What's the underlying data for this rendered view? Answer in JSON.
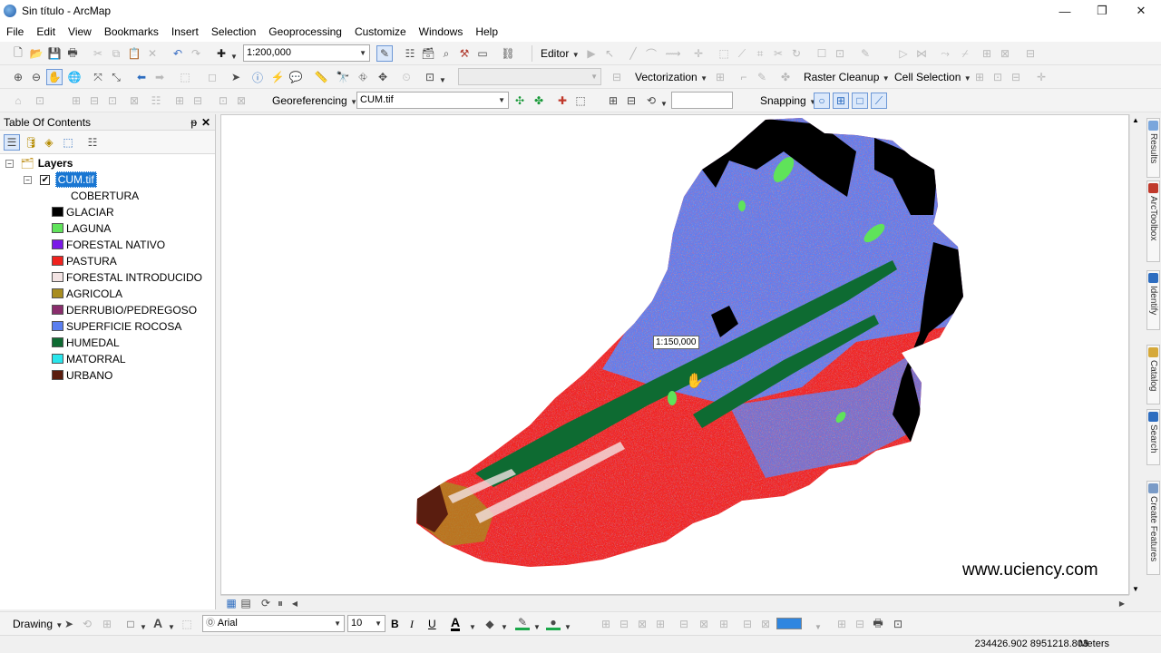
{
  "window": {
    "title": "Sin título - ArcMap"
  },
  "menu": [
    "File",
    "Edit",
    "View",
    "Bookmarks",
    "Insert",
    "Selection",
    "Geoprocessing",
    "Customize",
    "Windows",
    "Help"
  ],
  "toolbar": {
    "scale": "1:200,000",
    "editor": "Editor",
    "vectorization": "Vectorization",
    "raster_cleanup": "Raster Cleanup",
    "cell_selection": "Cell Selection",
    "georeferencing": "Georeferencing",
    "georef_layer": "CUM.tif",
    "snapping": "Snapping"
  },
  "toc": {
    "title": "Table Of Contents",
    "pin": "ᵽ",
    "close": "✕",
    "layers_label": "Layers",
    "layer_name": "CUM.tif",
    "field_name": "COBERTURA",
    "classes": [
      {
        "label": "GLACIAR",
        "color": "#000000"
      },
      {
        "label": "LAGUNA",
        "color": "#5fe35a"
      },
      {
        "label": "FORESTAL NATIVO",
        "color": "#7a18e8"
      },
      {
        "label": "PASTURA",
        "color": "#f0221e"
      },
      {
        "label": "FORESTAL INTRODUCIDO",
        "color": "#f3e4e4"
      },
      {
        "label": "AGRICOLA",
        "color": "#a88d1f"
      },
      {
        "label": "DERRUBIO/PEDREGOSO",
        "color": "#8a2d6d"
      },
      {
        "label": "SUPERFICIE ROCOSA",
        "color": "#5b7ff0"
      },
      {
        "label": "HUMEDAL",
        "color": "#0e6b32"
      },
      {
        "label": "MATORRAL",
        "color": "#29e6ec"
      },
      {
        "label": "URBANO",
        "color": "#5a1d0f"
      }
    ]
  },
  "map": {
    "scale_tip": "1:150,000",
    "watermark": "www.uciency.com"
  },
  "side_tabs": [
    "Results",
    "ArcToolbox",
    "Identify",
    "Catalog",
    "Search",
    "Create Features"
  ],
  "drawing": {
    "label": "Drawing",
    "font": "Arial",
    "size": "10",
    "bold": "B",
    "italic": "I",
    "underline": "U",
    "text_color": "A"
  },
  "status": {
    "coords": "234426.902  8951218.803",
    "units": "Meters"
  }
}
